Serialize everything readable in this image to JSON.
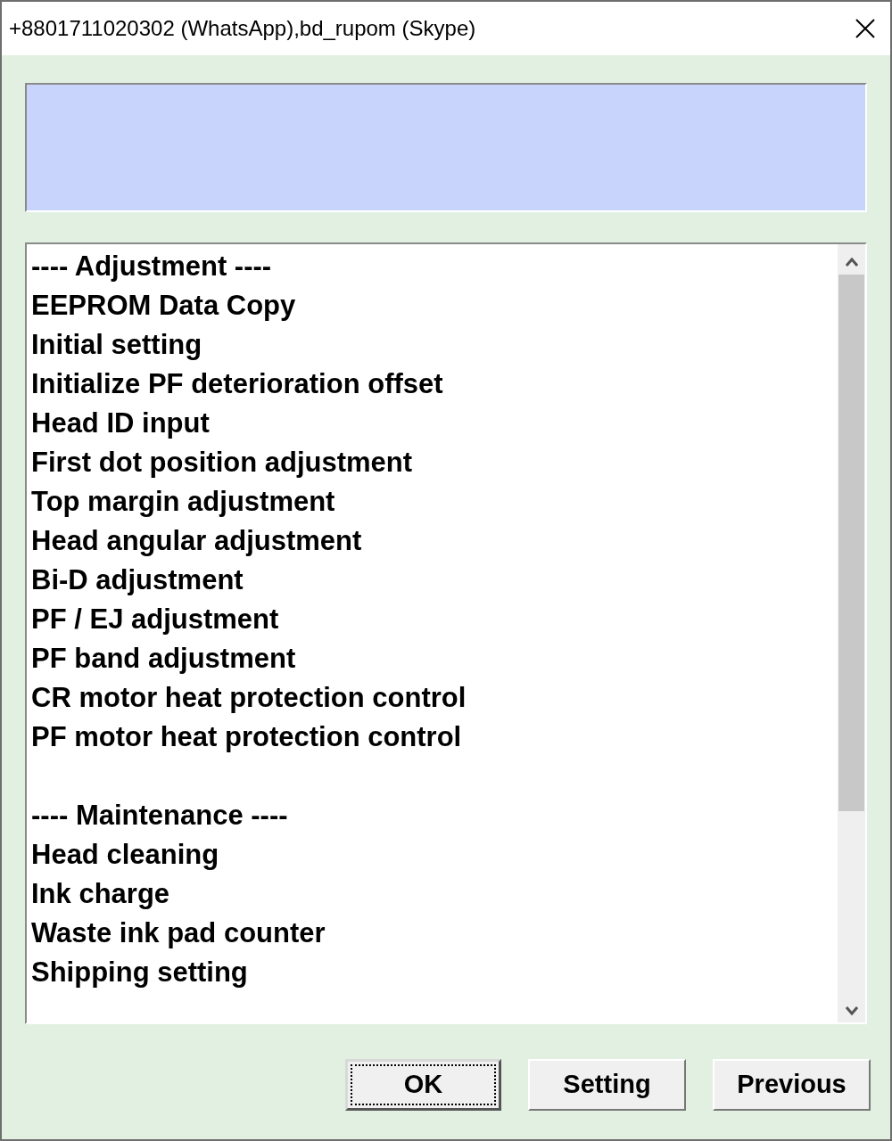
{
  "window": {
    "title": "+8801711020302 (WhatsApp),bd_rupom (Skype)"
  },
  "list": {
    "sections": [
      {
        "header": "---- Adjustment ----",
        "items": [
          "EEPROM Data Copy",
          "Initial setting",
          "Initialize PF deterioration offset",
          "Head ID input",
          "First dot position adjustment",
          "Top margin adjustment",
          "Head angular adjustment",
          "Bi-D adjustment",
          "PF / EJ adjustment",
          "PF band adjustment",
          "CR motor heat protection control",
          "PF motor heat protection control"
        ]
      },
      {
        "header": "---- Maintenance ----",
        "items": [
          "Head cleaning",
          "Ink charge",
          "Waste ink pad counter",
          "Shipping setting"
        ]
      }
    ]
  },
  "buttons": [
    {
      "label": "OK",
      "default": true
    },
    {
      "label": "Setting",
      "default": false
    },
    {
      "label": "Previous",
      "default": false
    }
  ]
}
